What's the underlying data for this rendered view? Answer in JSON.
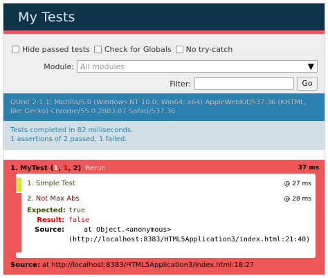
{
  "header": {
    "title": "My Tests"
  },
  "toolbar": {
    "hide_passed": "Hide passed tests",
    "check_globals": "Check for Globals",
    "no_try_catch": "No try-catch",
    "module_label": "Module:",
    "module_value": "All modules",
    "filter_label": "Filter:",
    "filter_value": "",
    "go_label": "Go"
  },
  "useragent": "QUnit 2.1.1; Mozilla/5.0 (Windows NT 10.0; Win64; x64) AppleWebKit/537.36 (KHTML, like Gecko) Chrome/55.0.2883.87 Safari/537.36",
  "summary": {
    "line1": "Tests completed in 82 milliseconds.",
    "line2": "1 assertions of 2 passed, 1 failed."
  },
  "module": {
    "name": "1. MyTest",
    "counts_open": "(",
    "failed": "1",
    "sep1": ", ",
    "passed": "1",
    "sep2": ", ",
    "total": "2",
    "counts_close": ")",
    "rerun": "Rerun",
    "time": "37 ms"
  },
  "assertions": [
    {
      "label": "1. Simple Test",
      "time": "@ 27 ms"
    },
    {
      "label": "2. Not Max Abs",
      "time": "@ 28 ms",
      "expected_key": "Expected:",
      "expected": "true",
      "result_key": "Result:",
      "result": "false",
      "source_key": "Source:",
      "source_line1": "at Object.<anonymous>",
      "source_line2": "(http://localhost:8383/HTML5Application3/index.html:21:40)"
    }
  ],
  "footer": {
    "source_key": "Source:",
    "source_value": "at http://localhost:8383/HTML5Application3/index.html:18:27"
  }
}
